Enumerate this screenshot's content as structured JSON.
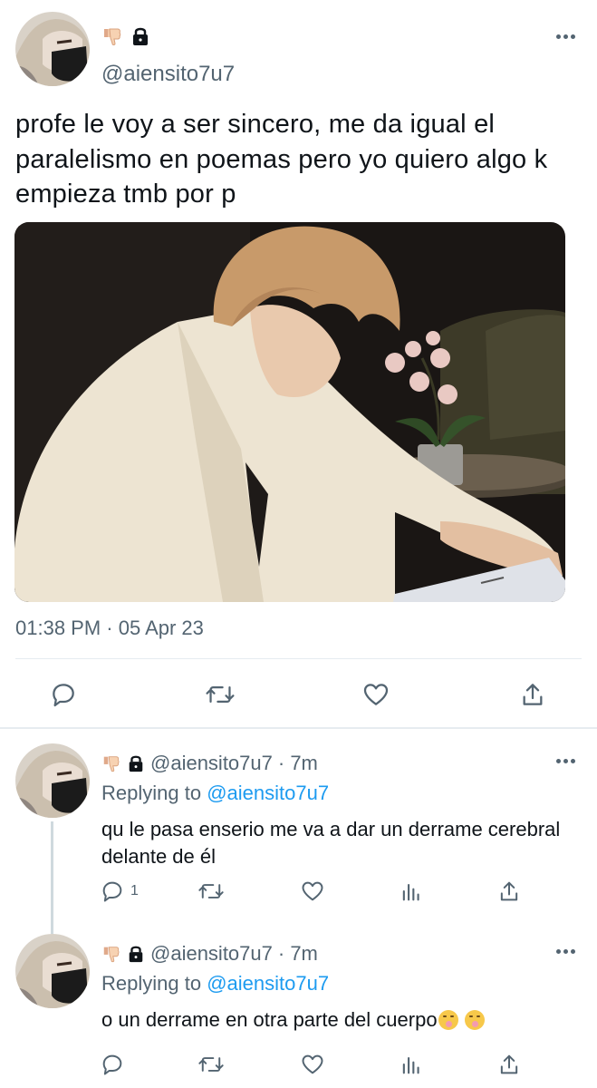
{
  "main_tweet": {
    "handle": "@aiensito7u7",
    "text": "profe le voy a ser sincero, me da igual el paralelismo en poemas pero yo quiero algo k empieza tmb por p",
    "timestamp": "01:38 PM · 05 Apr 23",
    "name_icons": [
      "thumbs-down-emoji",
      "lock-icon"
    ]
  },
  "replies": [
    {
      "handle": "@aiensito7u7",
      "time": "· 7m",
      "replying_label": "Replying to",
      "replying_handle": "@aiensito7u7",
      "text": "qu le pasa enserio me va a dar un derrame cerebral delante de él",
      "reply_count": "1"
    },
    {
      "handle": "@aiensito7u7",
      "time": "· 7m",
      "replying_label": "Replying to",
      "replying_handle": "@aiensito7u7",
      "text": "o un derrame en otra parte del cuerpo",
      "reply_count": ""
    }
  ],
  "colors": {
    "text": "#0f1419",
    "muted": "#536471",
    "link": "#1d9bf0",
    "divider": "#e6ecf0"
  }
}
